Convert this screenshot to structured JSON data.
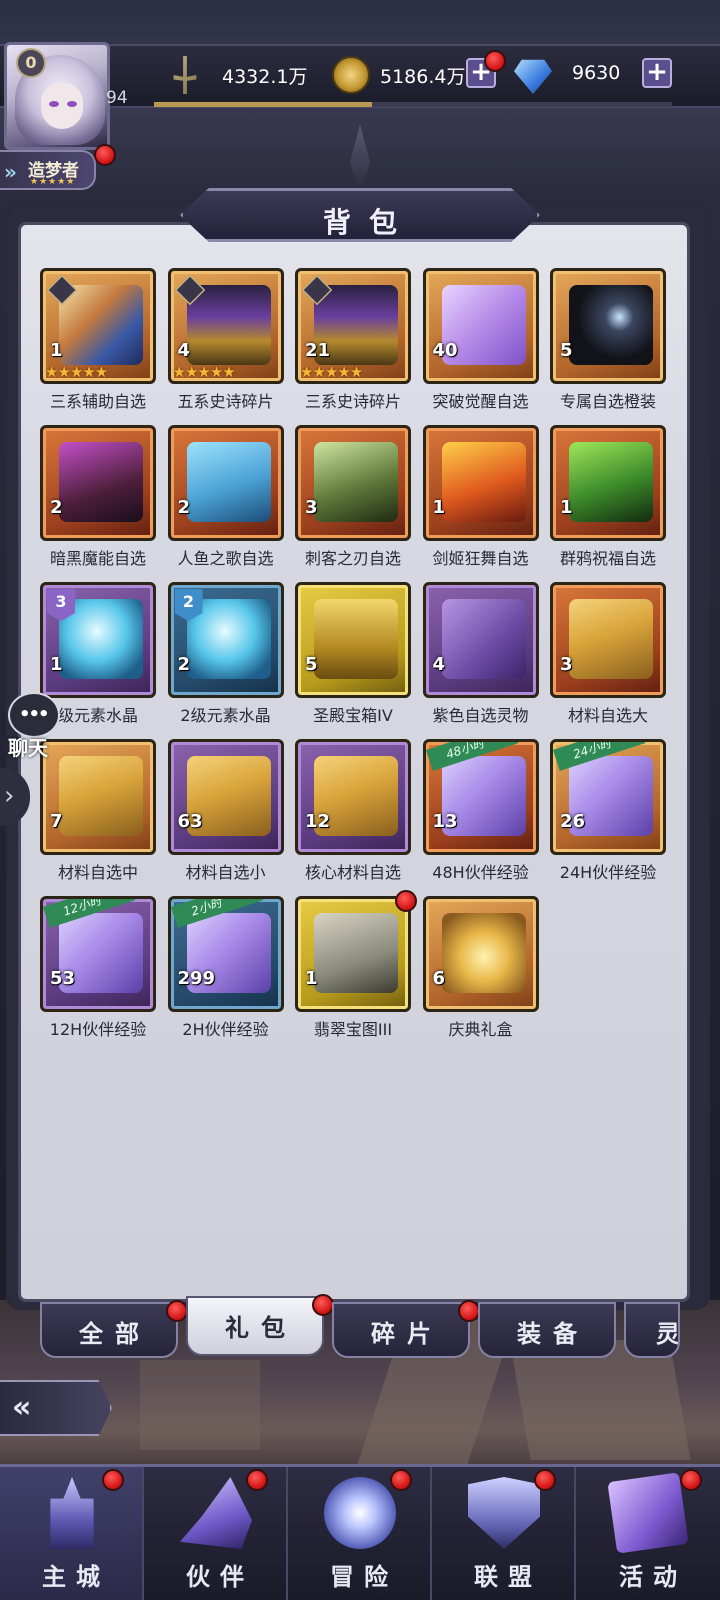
{
  "header": {
    "vip_level": "0",
    "player_level": "94",
    "title_label": "造梦者",
    "title_stars": "★★★★★",
    "power": "4332.1万",
    "gold": "5186.4万",
    "diamonds": "9630",
    "xp_progress": 0.42,
    "plus_label": "+"
  },
  "panel": {
    "title": "背包"
  },
  "items": [
    {
      "count": "1",
      "name": "三系辅助自选",
      "stars": "★★★★★"
    },
    {
      "count": "4",
      "name": "五系史诗碎片",
      "stars": "★★★★★"
    },
    {
      "count": "21",
      "name": "三系史诗碎片",
      "stars": "★★★★★"
    },
    {
      "count": "40",
      "name": "突破觉醒自选"
    },
    {
      "count": "5",
      "name": "专属自选橙装"
    },
    {
      "count": "2",
      "name": "暗黑魔能自选"
    },
    {
      "count": "2",
      "name": "人鱼之歌自选"
    },
    {
      "count": "3",
      "name": "刺客之刃自选"
    },
    {
      "count": "1",
      "name": "剑姬狂舞自选"
    },
    {
      "count": "1",
      "name": "群鸦祝福自选"
    },
    {
      "count": "1",
      "name": "级元素水晶",
      "level": "3"
    },
    {
      "count": "2",
      "name": "2级元素水晶",
      "level": "2"
    },
    {
      "count": "5",
      "name": "圣殿宝箱IV"
    },
    {
      "count": "4",
      "name": "紫色自选灵物"
    },
    {
      "count": "3",
      "name": "材料自选大"
    },
    {
      "count": "7",
      "name": "材料自选中"
    },
    {
      "count": "63",
      "name": "材料自选小"
    },
    {
      "count": "12",
      "name": "核心材料自选"
    },
    {
      "count": "13",
      "name": "48H伙伴经验",
      "ribbon": "48小时"
    },
    {
      "count": "26",
      "name": "24H伙伴经验",
      "ribbon": "24小时"
    },
    {
      "count": "53",
      "name": "12H伙伴经验",
      "ribbon": "12小时"
    },
    {
      "count": "299",
      "name": "2H伙伴经验",
      "ribbon": "2小时"
    },
    {
      "count": "1",
      "name": "翡翠宝图III"
    },
    {
      "count": "6",
      "name": "庆典礼盒"
    }
  ],
  "tabs": [
    "全部",
    "礼包",
    "碎片",
    "装备",
    "灵"
  ],
  "active_tab": "礼包",
  "chat": {
    "bubble": "•••",
    "label": "聊天"
  },
  "side_arrow": "›",
  "back_label": "«",
  "nav": [
    {
      "label": "主城",
      "icon": "castle-icon",
      "active": true
    },
    {
      "label": "伙伴",
      "icon": "wizard-hat-icon"
    },
    {
      "label": "冒险",
      "icon": "compass-icon"
    },
    {
      "label": "联盟",
      "icon": "shield-icon"
    },
    {
      "label": "活动",
      "icon": "cards-icon"
    }
  ],
  "colors": {
    "accent": "#5a4f8c",
    "badge_red": "#cf1111",
    "panel_bg": "#d7d8e2"
  }
}
